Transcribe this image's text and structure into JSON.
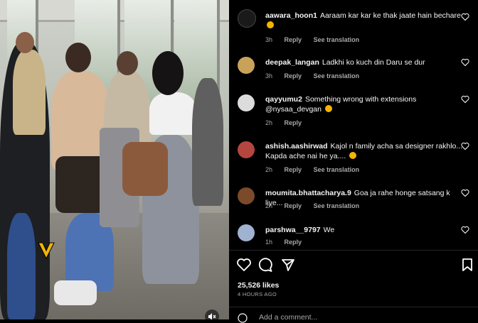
{
  "comments": [
    {
      "user": "aawara_hoon1",
      "text": "Aaraam kar kar ke thak jaate hain bechare",
      "emoji": true,
      "time": "3h",
      "reply": "Reply",
      "translate": "See translation"
    },
    {
      "user": "deepak_langan",
      "text": "Ladkhi ko kuch din Daru se dur",
      "emoji": false,
      "time": "3h",
      "reply": "Reply",
      "translate": "See translation"
    },
    {
      "user": "qayyumu2",
      "text": "Something wrong with extensions @nysaa_devgan",
      "emoji": true,
      "time": "2h",
      "reply": "Reply",
      "translate": ""
    },
    {
      "user": "ashish.aashirwad",
      "text": "Kajol n family acha sa designer rakhlo... Kapda ache nai he ya....",
      "emoji": true,
      "time": "2h",
      "reply": "Reply",
      "translate": "See translation"
    },
    {
      "user": "moumita.bhattacharya.9",
      "text": "Goa ja rahe honge satsang k liye...",
      "emoji": false,
      "time": "2h",
      "reply": "Reply",
      "translate": "See translation"
    },
    {
      "user": "parshwa__9797",
      "text": "We",
      "emoji": false,
      "time": "1h",
      "reply": "Reply",
      "translate": ""
    }
  ],
  "likes": "25,526 likes",
  "posted": "4 HOURS AGO",
  "add_comment_placeholder": "Add a comment...",
  "icons": {
    "like": "heart-icon",
    "comment": "comment-icon",
    "share": "share-icon",
    "save": "bookmark-icon",
    "mute": "speaker-muted-icon"
  }
}
